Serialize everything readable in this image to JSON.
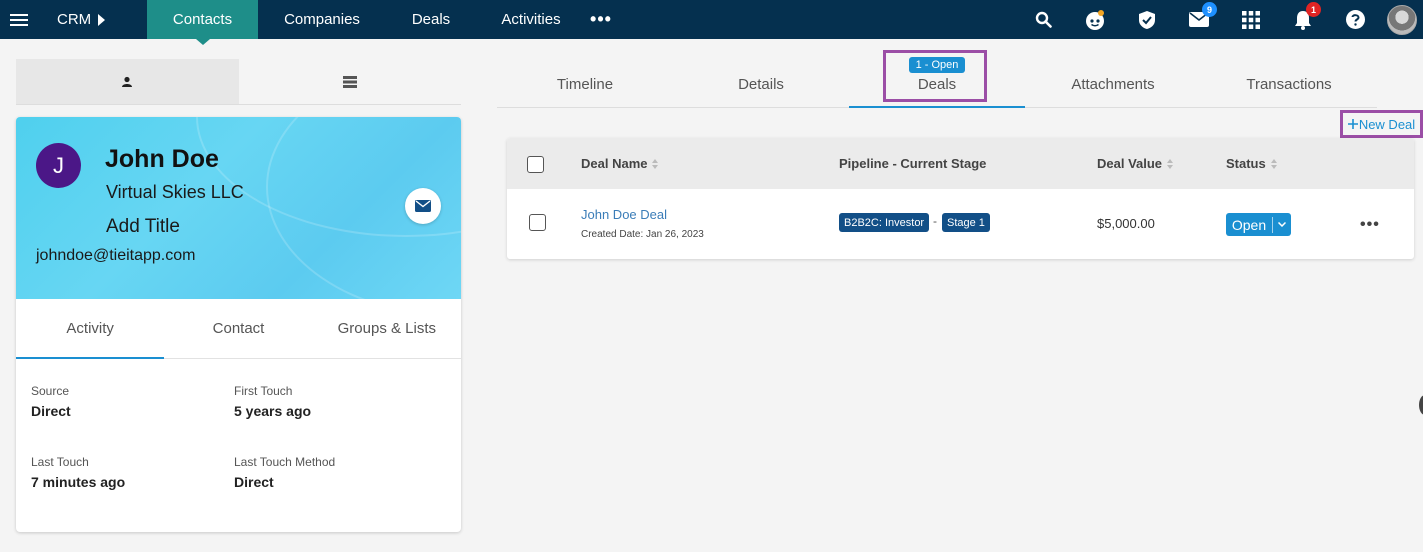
{
  "nav": {
    "app": "CRM",
    "items": [
      {
        "label": "Contacts",
        "active": true
      },
      {
        "label": "Companies",
        "active": false
      },
      {
        "label": "Deals",
        "active": false
      },
      {
        "label": "Activities",
        "active": false
      }
    ],
    "more": "•••",
    "badges": {
      "mail": "9",
      "notifications": "1"
    }
  },
  "contact": {
    "initial": "J",
    "name": "John Doe",
    "company": "Virtual Skies LLC",
    "title": "Add Title",
    "email": "johndoe@tieitapp.com",
    "tabs": [
      "Activity",
      "Contact",
      "Groups & Lists"
    ],
    "fields": {
      "source": {
        "label": "Source",
        "value": "Direct"
      },
      "first_touch": {
        "label": "First Touch",
        "value": "5 years ago"
      },
      "last_touch": {
        "label": "Last Touch",
        "value": "7 minutes ago"
      },
      "last_touch_method": {
        "label": "Last Touch Method",
        "value": "Direct"
      }
    }
  },
  "record_tabs": {
    "items": [
      "Timeline",
      "Details",
      "Deals",
      "Attachments",
      "Transactions"
    ],
    "active": "Deals",
    "deals_badge": "1 - Open"
  },
  "deals": {
    "new_deal": "New Deal",
    "columns": {
      "name": "Deal Name",
      "pipeline": "Pipeline - Current Stage",
      "value": "Deal Value",
      "status": "Status"
    },
    "rows": [
      {
        "name": "John Doe Deal",
        "created": "Created Date: Jan 26, 2023",
        "pipeline": "B2B2C: Investor",
        "separator": "-",
        "stage": "Stage 1",
        "value": "$5,000.00",
        "status": "Open"
      }
    ]
  },
  "colors": {
    "nav_bg": "#05304f",
    "nav_active": "#1e8e89",
    "accent": "#1a8fd1",
    "highlight": "#9b4ea6",
    "avatar": "#4b1787",
    "stage_badge": "#124f87"
  }
}
